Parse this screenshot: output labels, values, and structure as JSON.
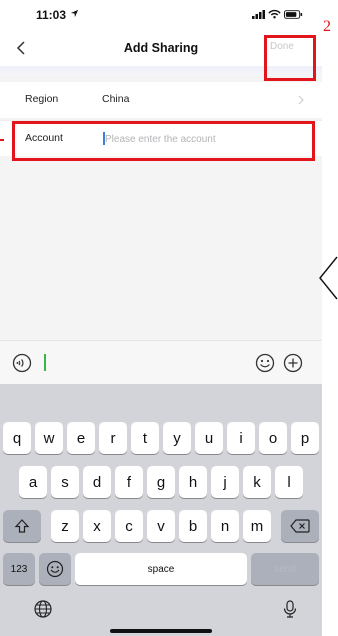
{
  "status_bar": {
    "time": "11:03"
  },
  "nav": {
    "title": "Add Sharing",
    "done_label": "Done"
  },
  "form": {
    "region_label": "Region",
    "region_value": "China",
    "account_label": "Account",
    "account_placeholder": "Please enter the account",
    "account_value": ""
  },
  "annotation": {
    "number": "2",
    "color": "#e2141c"
  },
  "keyboard": {
    "row1": [
      "q",
      "w",
      "e",
      "r",
      "t",
      "y",
      "u",
      "i",
      "o",
      "p"
    ],
    "row2": [
      "a",
      "s",
      "d",
      "f",
      "g",
      "h",
      "j",
      "k",
      "l"
    ],
    "row3": [
      "z",
      "x",
      "c",
      "v",
      "b",
      "n",
      "m"
    ],
    "numbers_label": "123",
    "space_label": "space",
    "send_label": "send"
  },
  "icons": [
    "back-icon",
    "location-arrow-icon",
    "signal-icon",
    "wifi-icon",
    "battery-icon",
    "chevron-right-icon",
    "voice-icon",
    "emoji-icon",
    "plus-icon",
    "shift-icon",
    "delete-icon",
    "emoji-keyboard-icon",
    "globe-icon",
    "microphone-icon"
  ],
  "colors": {
    "accent": "#3b7dd8",
    "annotation": "#e2141c",
    "keyboard_bg": "#d2d4da"
  }
}
